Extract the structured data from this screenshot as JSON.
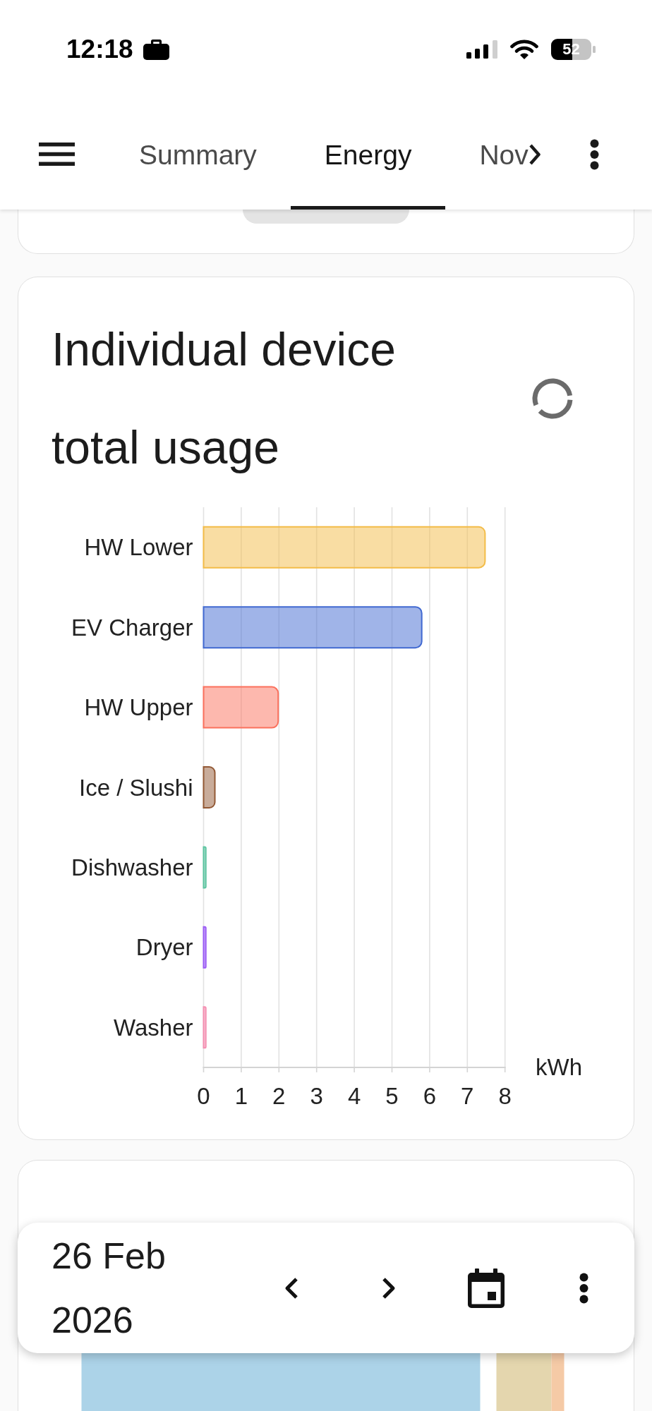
{
  "status_bar": {
    "time": "12:18",
    "battery": "52"
  },
  "app_bar": {
    "tabs": [
      {
        "label": "Summary",
        "selected": false
      },
      {
        "label": "Energy",
        "selected": true
      },
      {
        "label": "Nov",
        "selected": false
      }
    ]
  },
  "device_usage_card": {
    "title": "Individual device total usage",
    "loading": true,
    "chart_data": {
      "type": "bar",
      "orientation": "horizontal",
      "grid": true,
      "xlabel": "kWh",
      "xlim": [
        0,
        8
      ],
      "xticks": [
        0,
        1,
        2,
        3,
        4,
        5,
        6,
        7,
        8
      ],
      "series": [
        {
          "name": "HW Lower",
          "color": "#f3bc48",
          "values": [
            7.47
          ]
        },
        {
          "name": "EV Charger",
          "color": "#4169d1",
          "values": [
            5.79
          ]
        },
        {
          "name": "HW Upper",
          "color": "#fb715d",
          "values": [
            1.98
          ]
        },
        {
          "name": "Ice / Slushi",
          "color": "#935935",
          "values": [
            0.3
          ]
        },
        {
          "name": "Dishwasher",
          "color": "#5cc4a0",
          "values": [
            0.06
          ]
        },
        {
          "name": "Dryer",
          "color": "#9b5cf5",
          "values": [
            0.06
          ]
        },
        {
          "name": "Washer",
          "color": "#f48fb1",
          "values": [
            0.06
          ]
        }
      ]
    }
  },
  "date_bar": {
    "date": "26 Feb 2026"
  }
}
